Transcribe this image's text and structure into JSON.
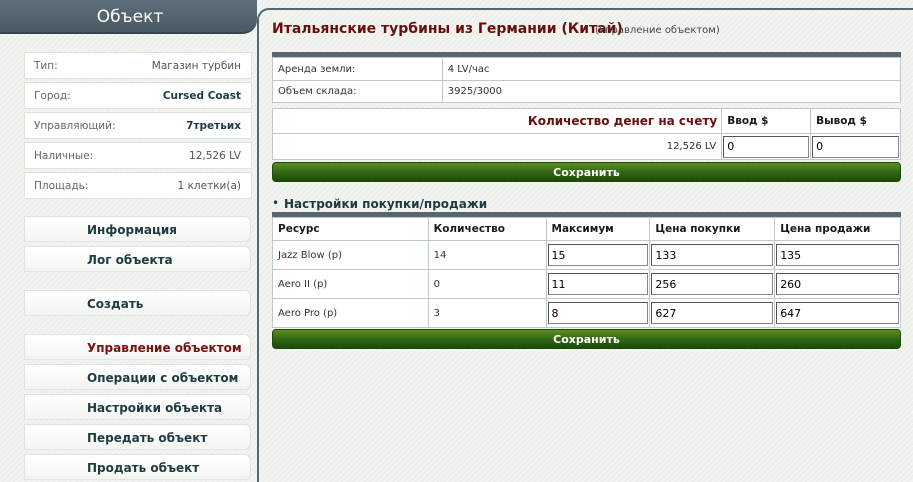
{
  "sidebar": {
    "title": "Объект",
    "info": [
      {
        "label": "Тип:",
        "value": "Магазин турбин"
      },
      {
        "label": "Город:",
        "value": "Cursed Coast"
      },
      {
        "label": "Управляющий:",
        "value": "7третьих"
      },
      {
        "label": "Наличные:",
        "value": "12,526 LV"
      },
      {
        "label": "Площадь:",
        "value": "1 клетки(а)"
      }
    ],
    "menu": [
      {
        "label": "Информация"
      },
      {
        "label": "Лог объекта"
      },
      {
        "label": "Создать"
      },
      {
        "label": "Управление объектом"
      },
      {
        "label": "Операции с объектом"
      },
      {
        "label": "Настройки объекта"
      },
      {
        "label": "Передать объект"
      },
      {
        "label": "Продать объект"
      }
    ]
  },
  "main": {
    "title": "Итальянские турбины из Германии (Китай)",
    "subtitle": "(Управление объектом)",
    "details": [
      {
        "label": "Аренда земли:",
        "value": "4 LV/час"
      },
      {
        "label": "Объем склада:",
        "value": "3925/3000"
      }
    ],
    "money": {
      "label": "Количество денег на счету",
      "deposit_header": "Ввод $",
      "withdraw_header": "Вывод $",
      "balance": "12,526 LV",
      "deposit_value": "0",
      "withdraw_value": "0"
    },
    "save_label": "Сохранить",
    "section_title": "Настройки покупки/продажи",
    "trade_table": {
      "headers": [
        "Ресурс",
        "Количество",
        "Максимум",
        "Цена покупки",
        "Цена продажи"
      ],
      "rows": [
        {
          "resource": "Jazz Blow (р)",
          "quantity": "14",
          "max": "15",
          "buy": "133",
          "sell": "135"
        },
        {
          "resource": "Aero II (р)",
          "quantity": "0",
          "max": "11",
          "buy": "256",
          "sell": "260"
        },
        {
          "resource": "Aero Pro (р)",
          "quantity": "3",
          "max": "8",
          "buy": "627",
          "sell": "647"
        }
      ]
    },
    "save_label_2": "Сохранить"
  },
  "colors": {
    "header_bg": "#4f5f69",
    "title_red": "#6b0d0d",
    "nav_text": "#1d3b40",
    "button_green": "#2f6412"
  }
}
